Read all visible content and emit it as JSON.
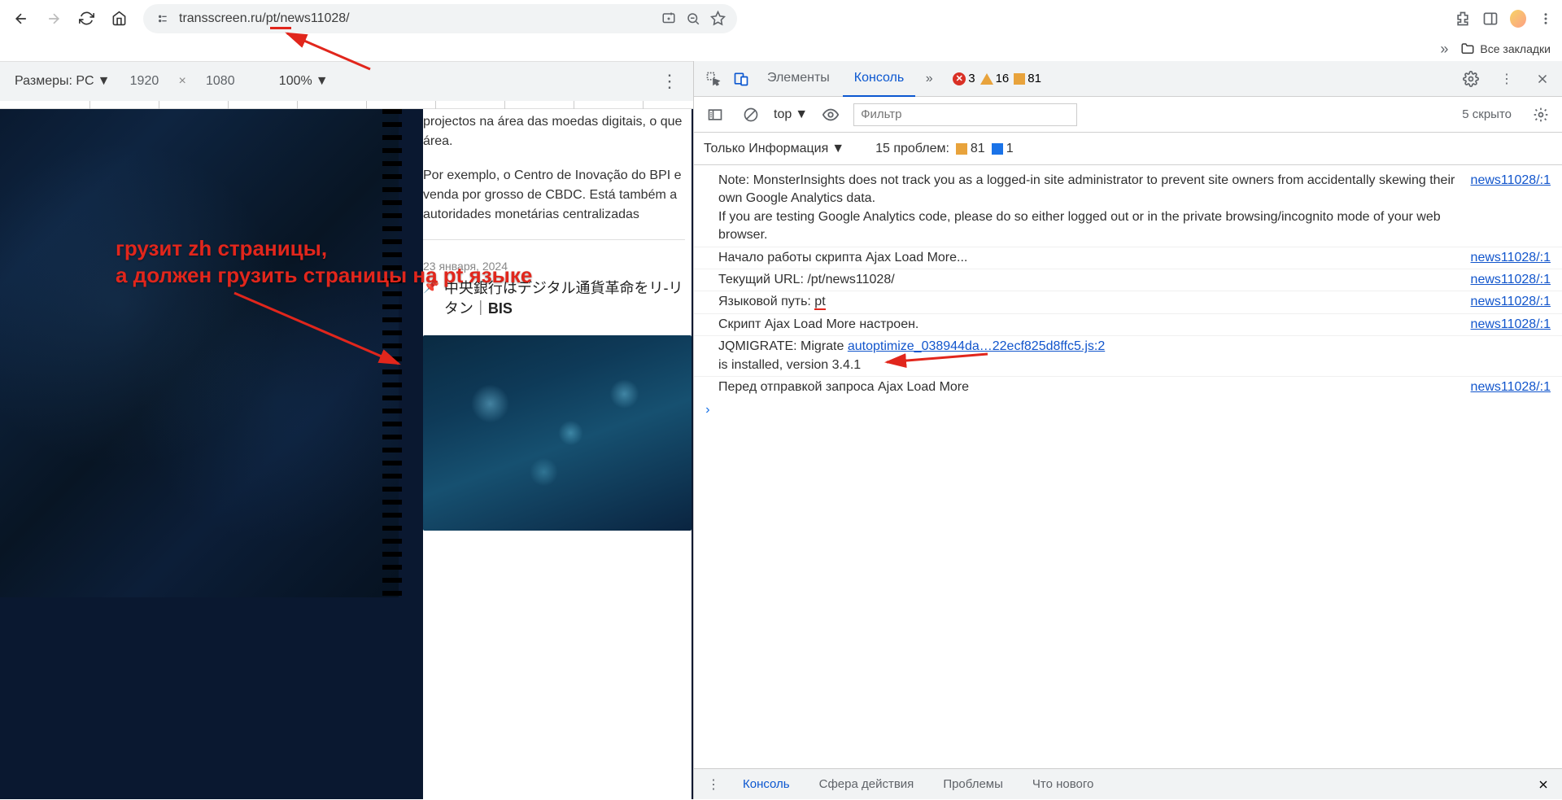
{
  "browser": {
    "url": "transscreen.ru/pt/news11028/"
  },
  "bookmarks": {
    "all": "Все закладки"
  },
  "device_toolbar": {
    "label": "Размеры: PC",
    "width": "1920",
    "height": "1080",
    "zoom": "100%"
  },
  "page": {
    "p1": "projectos na área das moedas digitais, o que área.",
    "p2": "Por exemplo, o Centro de Inovação do BPI e venda por grosso de CBDC. Está também a autoridades monetárias centralizadas",
    "date": "23 января, 2024",
    "title": "中央銀行はデジタル通貨革命をリ-リタン｜",
    "title_suffix": "BIS"
  },
  "annotations": {
    "line1": "грузит zh страницы,",
    "line2": "а должен грузить страницы на pt языке"
  },
  "devtools": {
    "tabs": {
      "elements": "Элементы",
      "console": "Консоль"
    },
    "counts": {
      "errors": "3",
      "warnings": "16",
      "issues": "81"
    },
    "sub": {
      "scope": "top",
      "filter_placeholder": "Фильтр",
      "hidden": "5 скрыто"
    },
    "filter": {
      "level": "Только Информация",
      "problems": "15 проблем:",
      "p81": "81",
      "p1": "1"
    },
    "logs": [
      {
        "msg": "Note: MonsterInsights does not track you as a logged-in site administrator to prevent site owners from accidentally skewing their own Google Analytics data.\nIf you are testing Google Analytics code, please do so either logged out or in the private browsing/incognito mode of your web browser.",
        "src": "news11028/:1"
      },
      {
        "msg": "Начало работы скрипта Ajax Load More...",
        "src": "news11028/:1"
      },
      {
        "msg": "Текущий URL: /pt/news11028/",
        "src": "news11028/:1"
      },
      {
        "msg_pre": "Языковой путь: ",
        "msg_hl": "pt",
        "src": "news11028/:1"
      },
      {
        "msg": "Скрипт Ajax Load More настроен.",
        "src": "news11028/:1"
      },
      {
        "msg_pre": "JQMIGRATE: Migrate ",
        "link": "autoptimize_038944da…22ecf825d8ffc5.js:2",
        "msg_post": "\nis installed, version 3.4.1"
      },
      {
        "msg": "Перед отправкой запроса Ajax Load More",
        "src": "news11028/:1"
      }
    ],
    "footer": {
      "console": "Консоль",
      "scope": "Сфера действия",
      "problems": "Проблемы",
      "whatsnew": "Что нового"
    }
  }
}
